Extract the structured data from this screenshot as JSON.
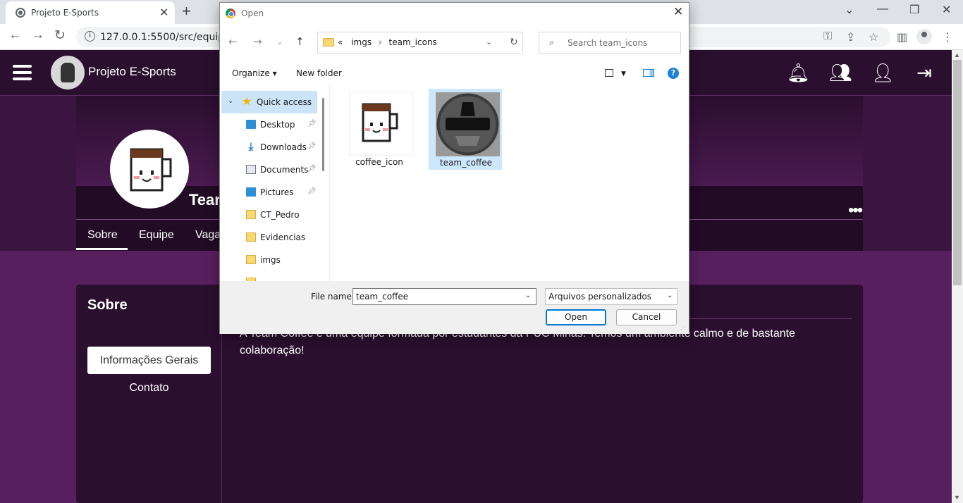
{
  "browser": {
    "tab_title": "Projeto E-Sports",
    "url": "127.0.0.1:5500/src/equipe.h"
  },
  "site": {
    "title": "Projeto E-Sports",
    "team_name": "Tear",
    "more_label": "•••",
    "tabs": [
      "Sobre",
      "Equipe",
      "Vaga"
    ],
    "section_title": "Sobre",
    "btn_info": "Informações Gerais",
    "btn_contato": "Contato",
    "about_text": "A Team Coffee é uma equipe formada por estudantes da PUC Minas. Temos um ambiente calmo e de bastante colaboração!"
  },
  "dialog": {
    "title": "Open",
    "breadcrumb": [
      "«",
      "imgs",
      "team_icons"
    ],
    "search_placeholder": "Search team_icons",
    "organize_label": "Organize ▾",
    "new_folder_label": "New folder",
    "help_label": "?",
    "nav_items": [
      {
        "label": "Quick access",
        "icon": "star-icon"
      },
      {
        "label": "Desktop",
        "icon": "desktop-icon",
        "pinned": true
      },
      {
        "label": "Downloads",
        "icon": "download-icon",
        "pinned": true
      },
      {
        "label": "Documents",
        "icon": "documents-icon",
        "pinned": true
      },
      {
        "label": "Pictures",
        "icon": "pictures-icon",
        "pinned": true
      },
      {
        "label": "CT_Pedro",
        "icon": "folder-icon"
      },
      {
        "label": "Evidencias",
        "icon": "folder-icon"
      },
      {
        "label": "imgs",
        "icon": "folder-icon"
      }
    ],
    "files": [
      {
        "name": "coffee_icon",
        "selected": false
      },
      {
        "name": "team_coffee",
        "selected": true
      }
    ],
    "file_name_label": "File name:",
    "file_name_value": "team_coffee",
    "file_type_value": "Arquivos personalizados",
    "open_label": "Open",
    "cancel_label": "Cancel"
  },
  "colors": {
    "header": "#2a0f2e",
    "page": "#581f5f",
    "accent_blue": "#0078d4",
    "selection": "#cce8ff"
  }
}
